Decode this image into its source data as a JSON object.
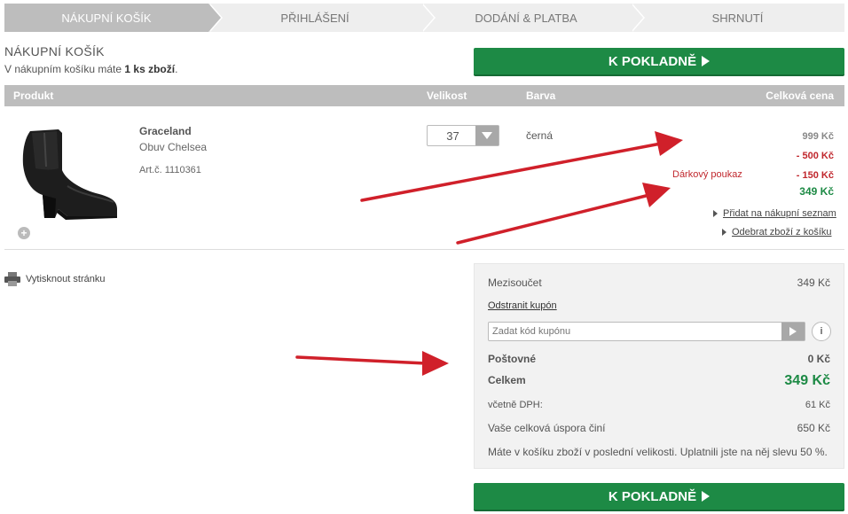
{
  "steps": [
    {
      "label": "NÁKUPNÍ KOŠÍK"
    },
    {
      "label": "PŘIHLÁŠENÍ"
    },
    {
      "label": "DODÁNÍ & PLATBA"
    },
    {
      "label": "SHRNUTÍ"
    }
  ],
  "cart": {
    "title": "NÁKUPNÍ KOŠÍK",
    "info_prefix": "V nákupním košíku máte ",
    "info_count": "1 ks zboží",
    "info_suffix": ".",
    "checkout_label": "K POKLADNĚ"
  },
  "table": {
    "col_product": "Produkt",
    "col_size": "Velikost",
    "col_color": "Barva",
    "col_total": "Celková cena"
  },
  "product": {
    "name": "Graceland",
    "subtitle": "Obuv Chelsea",
    "article": "Art.č.  1110361",
    "size": "37",
    "color": "černá",
    "price_original": "999 Kč",
    "discount": "- 500 Kč",
    "voucher_label": "Dárkový poukaz",
    "voucher_amount": "- 150 Kč",
    "price_final": "349 Kč",
    "add_wishlist": "Přidat na nákupní seznam",
    "remove": "Odebrat zboží z košíku"
  },
  "print_label": "Vytisknout stránku",
  "summary": {
    "subtotal_label": "Mezisoučet",
    "subtotal_value": "349 Kč",
    "remove_coupon": "Odstranit kupón",
    "coupon_placeholder": "Zadat kód kupónu",
    "info_label": "i",
    "shipping_label": "Poštovné",
    "shipping_value": "0 Kč",
    "total_label": "Celkem",
    "total_value": "349 Kč",
    "vat_label": "včetně DPH:",
    "vat_value": "61 Kč",
    "savings_label": "Vaše celková úspora činí",
    "savings_value": "650 Kč",
    "note": "Máte v košíku zboží v poslední velikosti. Uplatnili jste na něj slevu 50 %."
  },
  "colors": {
    "accent_green": "#1d8a45",
    "discount_red": "#c0272d",
    "annotation_arrow": "#d0202a"
  }
}
